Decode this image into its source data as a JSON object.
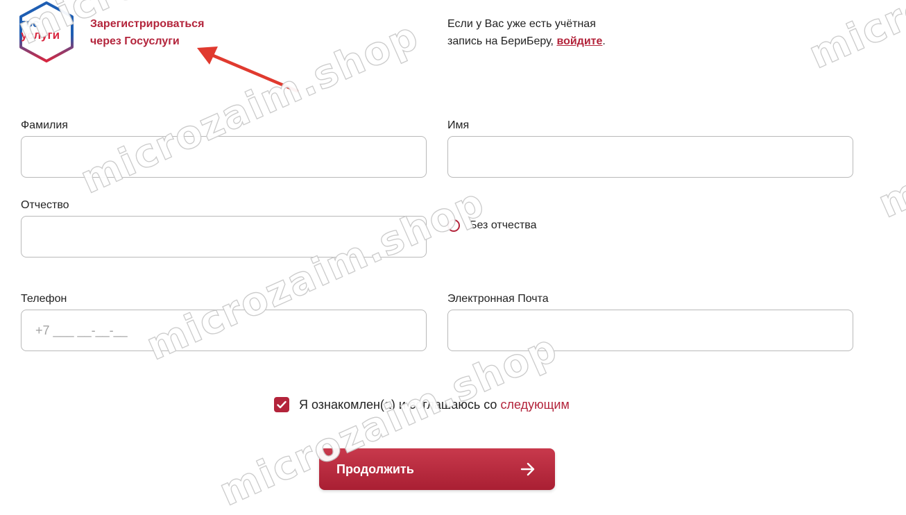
{
  "gosuslugi": {
    "logo_line1": "гос",
    "logo_line2": "услуги",
    "register_line1": "Зарегистрироваться",
    "register_line2": "через Госуслуги"
  },
  "login_hint": {
    "line1": "Если у Вас уже есть учётная",
    "line2_prefix": "запись на БериБеру, ",
    "link": "войдите",
    "line2_suffix": "."
  },
  "form": {
    "surname_label": "Фамилия",
    "name_label": "Имя",
    "patronymic_label": "Отчество",
    "no_patronymic_label": "Без отчества",
    "phone_label": "Телефон",
    "phone_placeholder": "+7 ___ __-__-__",
    "email_label": "Электронная Почта",
    "surname_value": "",
    "name_value": "",
    "patronymic_value": "",
    "email_value": ""
  },
  "consent": {
    "checked": true,
    "text": "Я ознакомлен(а) и соглашаюсь со",
    "link": "следующим"
  },
  "submit_label": "Продолжить",
  "watermark_text": "microzaim.shop",
  "colors": {
    "brand_red": "#b3243b",
    "gosuslugi_blue": "#1e5eb3",
    "border_gray": "#b9b9b9"
  },
  "icons": {
    "submit": "arrow-right-icon",
    "checkbox": "checkmark-icon",
    "logo": "gosuslugi-logo"
  }
}
